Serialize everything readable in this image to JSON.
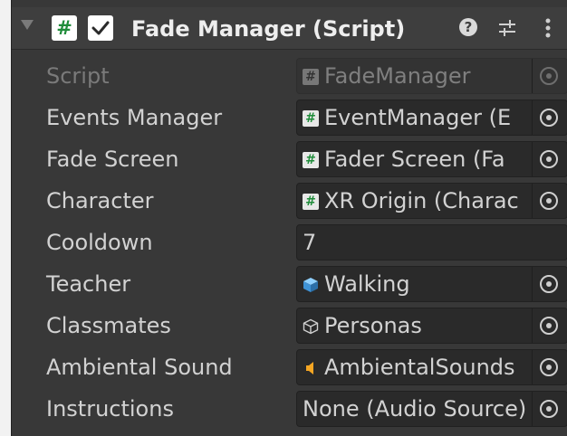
{
  "component": {
    "title": "Fade Manager (Script)",
    "script_icon_glyph": "#",
    "enabled": true,
    "help_glyph": "?"
  },
  "fields": [
    {
      "label": "Script",
      "value": "FadeManager",
      "icon": "script-icon",
      "disabled": true
    },
    {
      "label": "Events Manager",
      "value": "EventManager (E",
      "icon": "script-icon"
    },
    {
      "label": "Fade Screen",
      "value": "Fader Screen (Fa",
      "icon": "script-icon"
    },
    {
      "label": "Character",
      "value": "XR Origin (Charac",
      "icon": "script-icon"
    },
    {
      "label": "Cooldown",
      "value": "7"
    },
    {
      "label": "Teacher",
      "value": "Walking",
      "icon": "prefab-icon"
    },
    {
      "label": "Classmates",
      "value": "Personas",
      "icon": "prefab-outline-icon"
    },
    {
      "label": "Ambiental Sound",
      "value": "AmbientalSounds",
      "icon": "audio-source-icon"
    },
    {
      "label": "Instructions",
      "value": "None (Audio Source)"
    }
  ],
  "colors": {
    "panel": "#383838",
    "field": "#2a2a2a",
    "script_green": "#1f8c3a",
    "audio_orange": "#f5a623",
    "prefab_blue": "#4aa3e0"
  }
}
